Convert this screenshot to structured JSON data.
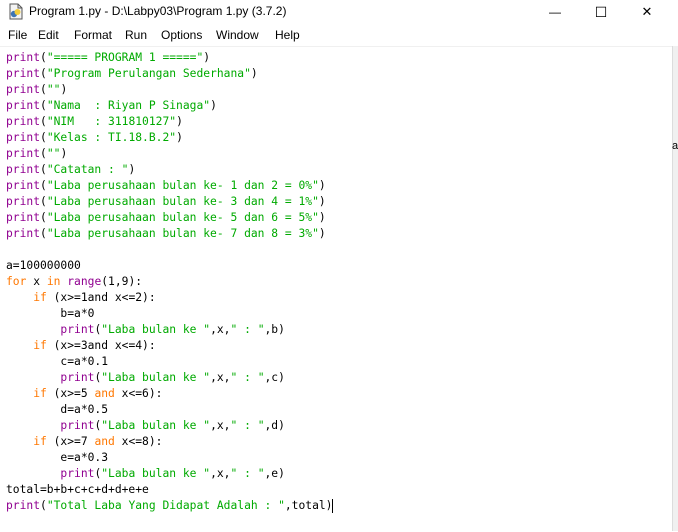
{
  "window": {
    "title": "Program 1.py - D:\\Labpy03\\Program 1.py (3.7.2)",
    "minimize_glyph": "—",
    "maximize_glyph": "☐",
    "close_glyph": "✕"
  },
  "menu": [
    "File",
    "Edit",
    "Format",
    "Run",
    "Options",
    "Window",
    "Help"
  ],
  "side_text": "a",
  "code": [
    [
      [
        "b",
        "print"
      ],
      [
        "p",
        "("
      ],
      [
        "s",
        "\"===== PROGRAM 1 =====\""
      ],
      [
        "p",
        ")"
      ]
    ],
    [
      [
        "b",
        "print"
      ],
      [
        "p",
        "("
      ],
      [
        "s",
        "\"Program Perulangan Sederhana\""
      ],
      [
        "p",
        ")"
      ]
    ],
    [
      [
        "b",
        "print"
      ],
      [
        "p",
        "("
      ],
      [
        "s",
        "\"\""
      ],
      [
        "p",
        ")"
      ]
    ],
    [
      [
        "b",
        "print"
      ],
      [
        "p",
        "("
      ],
      [
        "s",
        "\"Nama  : Riyan P Sinaga\""
      ],
      [
        "p",
        ")"
      ]
    ],
    [
      [
        "b",
        "print"
      ],
      [
        "p",
        "("
      ],
      [
        "s",
        "\"NIM   : 311810127\""
      ],
      [
        "p",
        ")"
      ]
    ],
    [
      [
        "b",
        "print"
      ],
      [
        "p",
        "("
      ],
      [
        "s",
        "\"Kelas : TI.18.B.2\""
      ],
      [
        "p",
        ")"
      ]
    ],
    [
      [
        "b",
        "print"
      ],
      [
        "p",
        "("
      ],
      [
        "s",
        "\"\""
      ],
      [
        "p",
        ")"
      ]
    ],
    [
      [
        "b",
        "print"
      ],
      [
        "p",
        "("
      ],
      [
        "s",
        "\"Catatan : \""
      ],
      [
        "p",
        ")"
      ]
    ],
    [
      [
        "b",
        "print"
      ],
      [
        "p",
        "("
      ],
      [
        "s",
        "\"Laba perusahaan bulan ke- 1 dan 2 = 0%\""
      ],
      [
        "p",
        ")"
      ]
    ],
    [
      [
        "b",
        "print"
      ],
      [
        "p",
        "("
      ],
      [
        "s",
        "\"Laba perusahaan bulan ke- 3 dan 4 = 1%\""
      ],
      [
        "p",
        ")"
      ]
    ],
    [
      [
        "b",
        "print"
      ],
      [
        "p",
        "("
      ],
      [
        "s",
        "\"Laba perusahaan bulan ke- 5 dan 6 = 5%\""
      ],
      [
        "p",
        ")"
      ]
    ],
    [
      [
        "b",
        "print"
      ],
      [
        "p",
        "("
      ],
      [
        "s",
        "\"Laba perusahaan bulan ke- 7 dan 8 = 3%\""
      ],
      [
        "p",
        ")"
      ]
    ],
    [],
    [
      [
        "p",
        "a=100000000"
      ]
    ],
    [
      [
        "k",
        "for"
      ],
      [
        "p",
        " x "
      ],
      [
        "k",
        "in"
      ],
      [
        "p",
        " "
      ],
      [
        "b",
        "range"
      ],
      [
        "p",
        "(1,9):"
      ]
    ],
    [
      [
        "p",
        "    "
      ],
      [
        "k",
        "if"
      ],
      [
        "p",
        " (x>=1and x<=2):"
      ]
    ],
    [
      [
        "p",
        "        b=a*0"
      ]
    ],
    [
      [
        "p",
        "        "
      ],
      [
        "b",
        "print"
      ],
      [
        "p",
        "("
      ],
      [
        "s",
        "\"Laba bulan ke \""
      ],
      [
        "p",
        ",x,"
      ],
      [
        "s",
        "\" : \""
      ],
      [
        "p",
        ",b)"
      ]
    ],
    [
      [
        "p",
        "    "
      ],
      [
        "k",
        "if"
      ],
      [
        "p",
        " (x>=3and x<=4):"
      ]
    ],
    [
      [
        "p",
        "        c=a*0.1"
      ]
    ],
    [
      [
        "p",
        "        "
      ],
      [
        "b",
        "print"
      ],
      [
        "p",
        "("
      ],
      [
        "s",
        "\"Laba bulan ke \""
      ],
      [
        "p",
        ",x,"
      ],
      [
        "s",
        "\" : \""
      ],
      [
        "p",
        ",c)"
      ]
    ],
    [
      [
        "p",
        "    "
      ],
      [
        "k",
        "if"
      ],
      [
        "p",
        " (x>=5 "
      ],
      [
        "k",
        "and"
      ],
      [
        "p",
        " x<=6):"
      ]
    ],
    [
      [
        "p",
        "        d=a*0.5"
      ]
    ],
    [
      [
        "p",
        "        "
      ],
      [
        "b",
        "print"
      ],
      [
        "p",
        "("
      ],
      [
        "s",
        "\"Laba bulan ke \""
      ],
      [
        "p",
        ",x,"
      ],
      [
        "s",
        "\" : \""
      ],
      [
        "p",
        ",d)"
      ]
    ],
    [
      [
        "p",
        "    "
      ],
      [
        "k",
        "if"
      ],
      [
        "p",
        " (x>=7 "
      ],
      [
        "k",
        "and"
      ],
      [
        "p",
        " x<=8):"
      ]
    ],
    [
      [
        "p",
        "        e=a*0.3"
      ]
    ],
    [
      [
        "p",
        "        "
      ],
      [
        "b",
        "print"
      ],
      [
        "p",
        "("
      ],
      [
        "s",
        "\"Laba bulan ke \""
      ],
      [
        "p",
        ",x,"
      ],
      [
        "s",
        "\" : \""
      ],
      [
        "p",
        ",e)"
      ]
    ],
    [
      [
        "p",
        "total=b+b+c+c+d+d+e+e"
      ]
    ],
    [
      [
        "b",
        "print"
      ],
      [
        "p",
        "("
      ],
      [
        "s",
        "\"Total Laba Yang Didapat Adalah : \""
      ],
      [
        "p",
        ",total)"
      ]
    ]
  ]
}
